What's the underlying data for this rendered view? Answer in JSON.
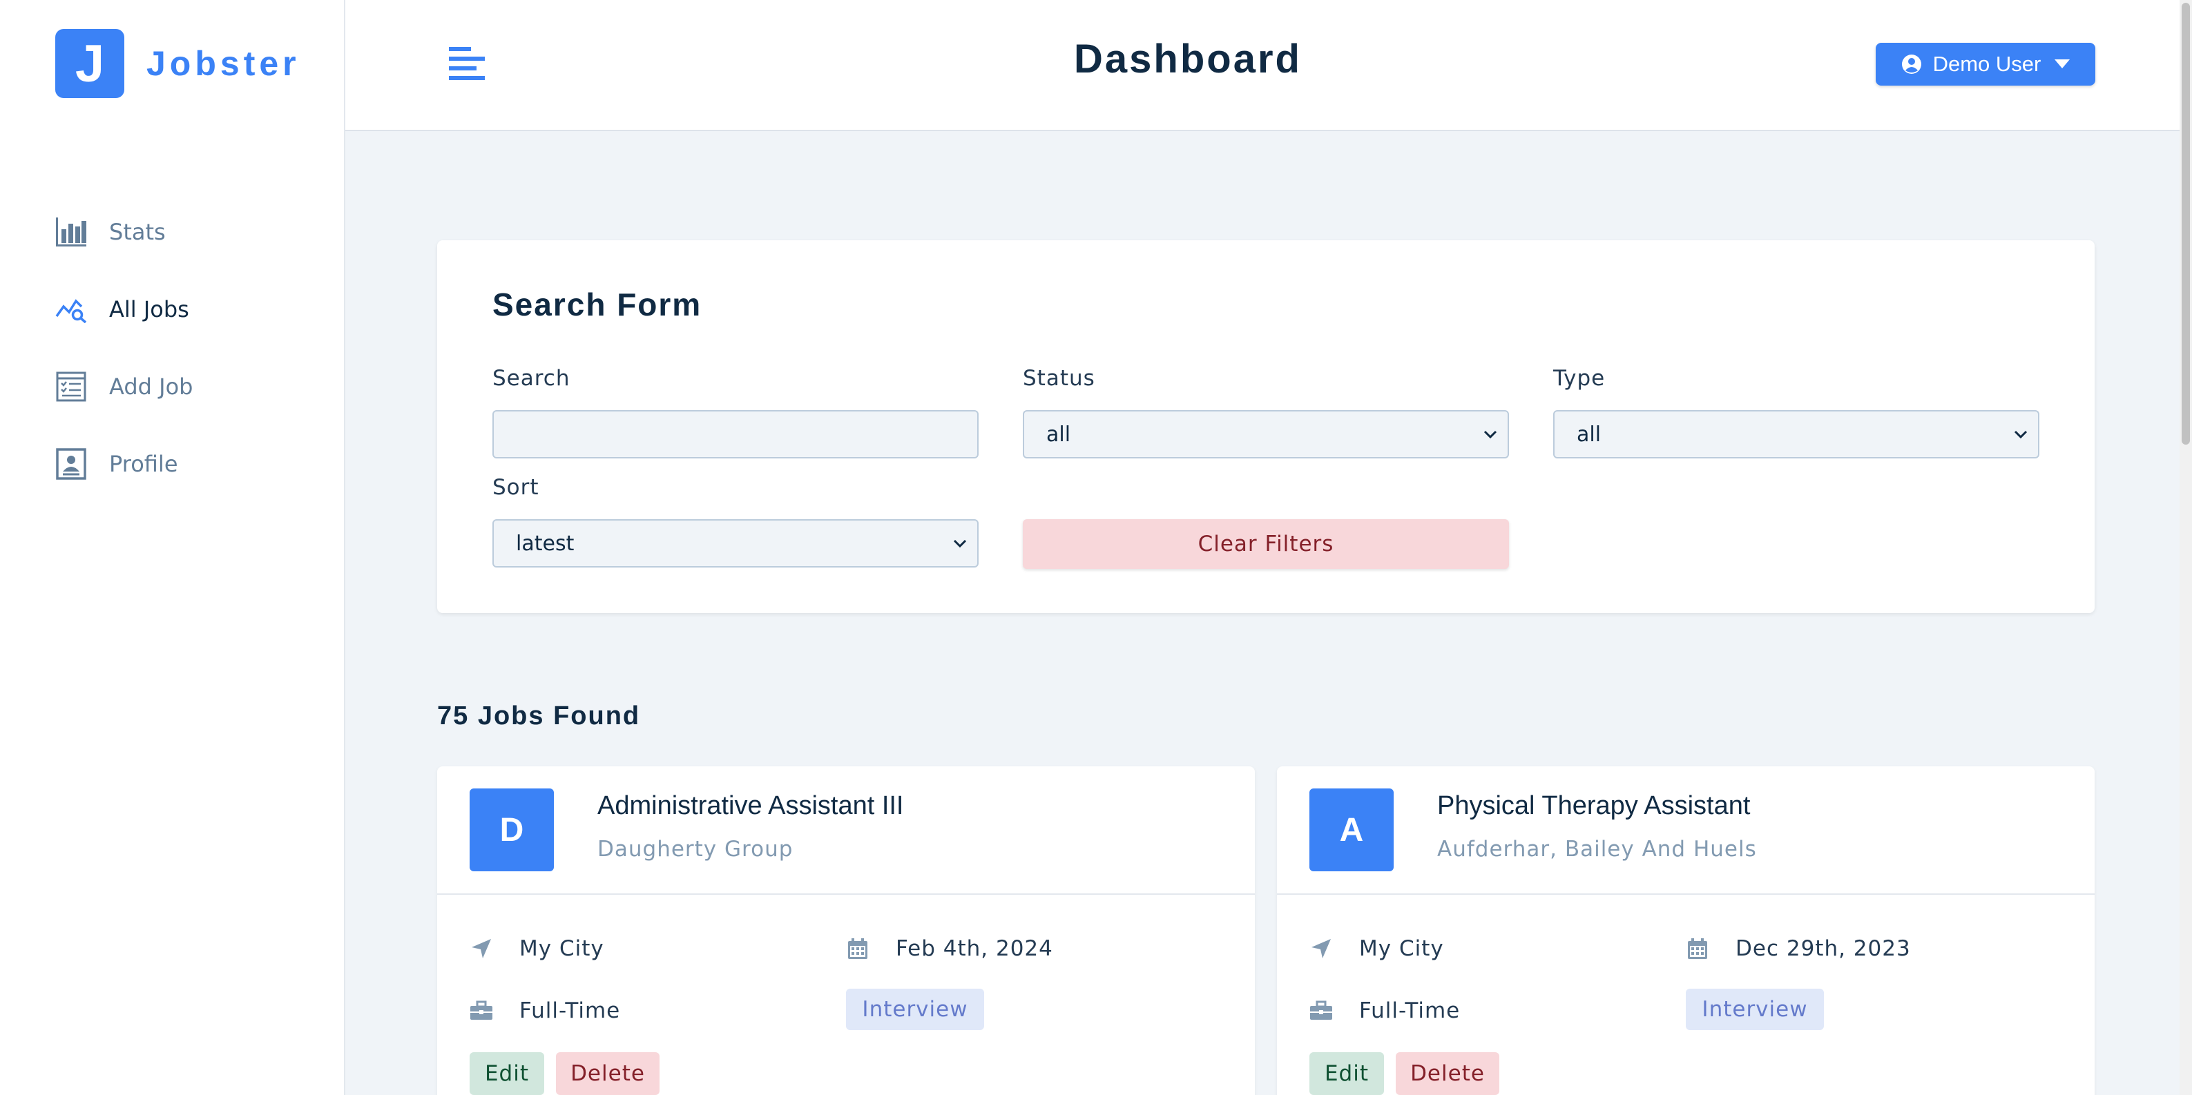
{
  "app": {
    "logo_letter": "J",
    "logo_text": "Jobster"
  },
  "sidebar": {
    "items": [
      {
        "label": "Stats",
        "icon": "bar-chart-icon"
      },
      {
        "label": "All Jobs",
        "icon": "query-stats-icon",
        "active": true
      },
      {
        "label": "Add Job",
        "icon": "form-icon"
      },
      {
        "label": "Profile",
        "icon": "profile-card-icon"
      }
    ]
  },
  "header": {
    "title": "Dashboard",
    "user_label": "Demo User"
  },
  "search_form": {
    "title": "Search Form",
    "search_label": "Search",
    "search_value": "",
    "status_label": "Status",
    "status_value": "all",
    "type_label": "Type",
    "type_value": "all",
    "sort_label": "Sort",
    "sort_value": "latest",
    "clear_label": "Clear Filters"
  },
  "jobs_count": "75 Jobs Found",
  "jobs": [
    {
      "initial": "D",
      "position": "Administrative Assistant III",
      "company": "Daugherty Group",
      "location": "My City",
      "date": "Feb 4th, 2024",
      "job_type": "Full-Time",
      "status": "Interview",
      "edit_label": "Edit",
      "delete_label": "Delete"
    },
    {
      "initial": "A",
      "position": "Physical Therapy Assistant",
      "company": "Aufderhar, Bailey And Huels",
      "location": "My City",
      "date": "Dec 29th, 2023",
      "job_type": "Full-Time",
      "status": "Interview",
      "edit_label": "Edit",
      "delete_label": "Delete"
    }
  ],
  "colors": {
    "primary": "#3b82f6",
    "background": "#f0f4f8",
    "danger_bg": "#f8d7da",
    "success_bg": "#d1e7dd",
    "interview_bg": "#e0e8f9"
  }
}
